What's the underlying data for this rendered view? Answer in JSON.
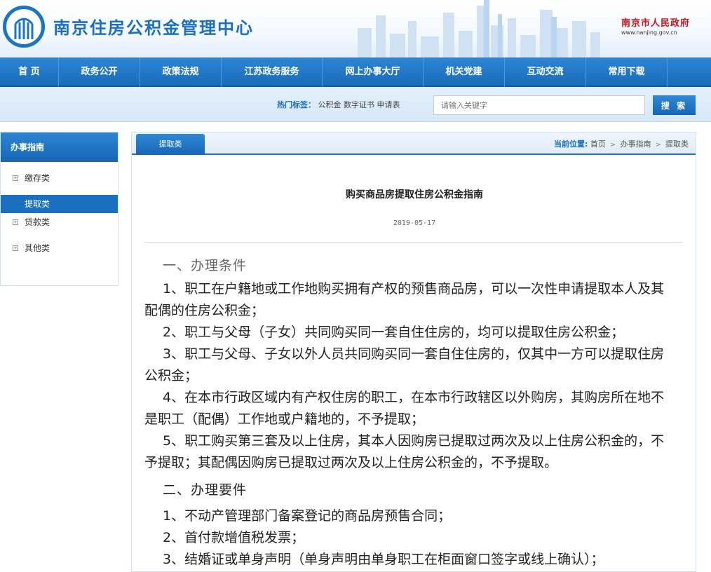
{
  "header": {
    "site_title": "南京住房公积金管理中心",
    "gov_name": "南京市人民政府",
    "gov_url": "www.nanjing.gov.cn"
  },
  "nav": [
    "首 页",
    "政务公开",
    "政策法规",
    "江苏政务服务",
    "网上办事大厅",
    "机关党建",
    "互动交流",
    "常用下载"
  ],
  "search": {
    "hot_label": "热门标签：",
    "hot_tags": [
      "公积金",
      "数字证书",
      "申请表"
    ],
    "placeholder": "请输入关键字",
    "button": "搜 索"
  },
  "sidebar": {
    "title": "办事指南",
    "items": [
      {
        "label": "缴存类",
        "bullet": "+"
      },
      {
        "label": "提取类",
        "bullet": ""
      },
      {
        "label": "贷款类",
        "bullet": "+"
      },
      {
        "label": "其他类",
        "bullet": "+"
      }
    ],
    "active_index": 1
  },
  "content": {
    "tab": "提取类",
    "breadcrumb": {
      "label": "当前位置:",
      "items": [
        "首页",
        "办事指南",
        "提取类"
      ]
    },
    "title": "购买商品房提取住房公积金指南",
    "date": "2019-05-17",
    "section1_title": "一、办理条件",
    "section1_items": [
      "1、职工在户籍地或工作地购买拥有产权的预售商品房，可以一次性申请提取本人及其配偶的住房公积金；",
      "2、职工与父母（子女）共同购买同一套自住住房的，均可以提取住房公积金；",
      "3、职工与父母、子女以外人员共同购买同一套自住住房的，仅其中一方可以提取住房公积金；",
      "4、在本市行政区域内有产权住房的职工，在本市行政辖区以外购房，其购房所在地不是职工（配偶）工作地或户籍地的，不予提取；",
      "5、职工购买第三套及以上住房，其本人因购房已提取过两次及以上住房公积金的，不予提取；其配偶因购房已提取过两次及以上住房公积金的，不予提取。"
    ],
    "section2_title": "二、办理要件",
    "section2_items": [
      "1、不动产管理部门备案登记的商品房预售合同；",
      "2、首付款增值税发票；",
      "3、结婚证或单身声明（单身声明由单身职工在柜面窗口签字或线上确认）；"
    ]
  },
  "colors": {
    "brand_blue": "#1a6fbf",
    "gov_red": "#c8141c"
  }
}
